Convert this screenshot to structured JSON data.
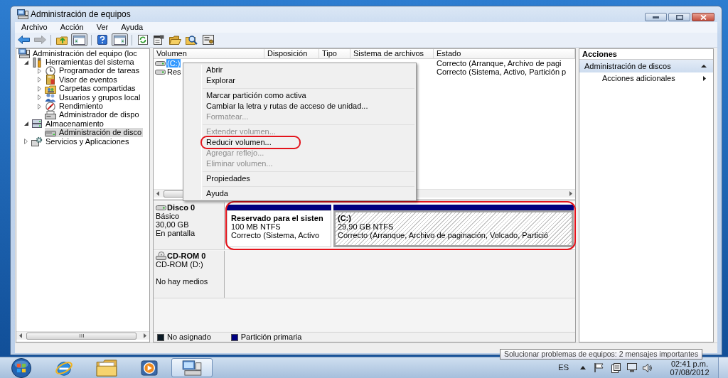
{
  "window": {
    "title": "Administración de equipos"
  },
  "menu_bar": [
    {
      "label": "Archivo"
    },
    {
      "label": "Acción"
    },
    {
      "label": "Ver"
    },
    {
      "label": "Ayuda"
    }
  ],
  "toolbar": [
    {
      "kind": "back",
      "disabled": false,
      "pressed": false
    },
    {
      "kind": "forward",
      "disabled": true,
      "pressed": false
    },
    {
      "kind": "separator"
    },
    {
      "kind": "up",
      "disabled": false,
      "pressed": false
    },
    {
      "kind": "console-tree",
      "disabled": false,
      "pressed": true
    },
    {
      "kind": "separator"
    },
    {
      "kind": "help",
      "disabled": false,
      "pressed": false
    },
    {
      "kind": "action-pane",
      "disabled": false,
      "pressed": true
    },
    {
      "kind": "separator"
    },
    {
      "kind": "refresh",
      "disabled": false,
      "pressed": false
    },
    {
      "kind": "properties",
      "disabled": false,
      "pressed": false
    },
    {
      "kind": "open",
      "disabled": false,
      "pressed": false
    },
    {
      "kind": "find",
      "disabled": false,
      "pressed": false
    },
    {
      "kind": "settings",
      "disabled": false,
      "pressed": false
    }
  ],
  "tree": {
    "label": "Administración del equipo (loc",
    "kind": "computer",
    "selected": false,
    "children": [
      {
        "label": "Herramientas del sistema",
        "kind": "tools",
        "expanded": true,
        "selected": false,
        "children": [
          {
            "label": "Programador de tareas",
            "kind": "clock",
            "expanded": false,
            "selected": false
          },
          {
            "label": "Visor de eventos",
            "kind": "events",
            "expanded": false,
            "selected": false
          },
          {
            "label": "Carpetas compartidas",
            "kind": "shared-folder",
            "expanded": false,
            "selected": false
          },
          {
            "label": "Usuarios y grupos local",
            "kind": "users",
            "expanded": false,
            "selected": false
          },
          {
            "label": "Rendimiento",
            "kind": "performance",
            "expanded": false,
            "selected": false
          },
          {
            "label": "Administrador de dispo",
            "kind": "devices",
            "selected": false
          }
        ]
      },
      {
        "label": "Almacenamiento",
        "kind": "storage",
        "expanded": true,
        "selected": false,
        "children": [
          {
            "label": "Administración de disco",
            "kind": "disk",
            "selected": true
          }
        ]
      },
      {
        "label": "Servicios y Aplicaciones",
        "kind": "services",
        "expanded": false,
        "selected": false
      }
    ]
  },
  "volume_table": {
    "columns": [
      "Volumen",
      "Disposición",
      "Tipo",
      "Sistema de archivos",
      "Estado"
    ],
    "rows": [
      {
        "volume": "(C:)",
        "status": "Correcto (Arranque, Archivo de pagi",
        "selected": true
      },
      {
        "volume": "Res",
        "status": "Correcto (Sistema, Activo, Partición p",
        "selected": false
      }
    ]
  },
  "context_menu": {
    "items": [
      {
        "kind": "item",
        "label": "Abrir",
        "disabled": false,
        "circled": false
      },
      {
        "kind": "item",
        "label": "Explorar",
        "disabled": false,
        "circled": false
      },
      {
        "kind": "separator"
      },
      {
        "kind": "item",
        "label": "Marcar partición como activa",
        "disabled": false,
        "circled": false
      },
      {
        "kind": "item",
        "label": "Cambiar la letra y rutas de acceso de unidad...",
        "disabled": false,
        "circled": false
      },
      {
        "kind": "item",
        "label": "Formatear...",
        "disabled": true,
        "circled": false
      },
      {
        "kind": "separator"
      },
      {
        "kind": "item",
        "label": "Extender volumen...",
        "disabled": true,
        "circled": false
      },
      {
        "kind": "item",
        "label": "Reducir volumen...",
        "disabled": false,
        "circled": true
      },
      {
        "kind": "item",
        "label": "Agregar reflejo...",
        "disabled": true,
        "circled": false
      },
      {
        "kind": "item",
        "label": "Eliminar volumen...",
        "disabled": true,
        "circled": false
      },
      {
        "kind": "separator"
      },
      {
        "kind": "item",
        "label": "Propiedades",
        "disabled": false,
        "circled": false
      },
      {
        "kind": "separator"
      },
      {
        "kind": "item",
        "label": "Ayuda",
        "disabled": false,
        "circled": false
      }
    ]
  },
  "disks": [
    {
      "kind": "disk",
      "name": "Disco 0",
      "type": "Básico",
      "size": "30,00 GB",
      "status": "En pantalla",
      "circled": true,
      "partitions": [
        {
          "name": "Reservado para el sisten",
          "size": "100 MB NTFS",
          "status": "Correcto (Sistema, Activo",
          "selected": false
        },
        {
          "name": "(C:)",
          "size": "29,90 GB NTFS",
          "status": "Correcto (Arranque, Archivo de paginación, Volcado, Partició",
          "selected": true
        }
      ]
    },
    {
      "kind": "cdrom",
      "name": "CD-ROM 0",
      "type": "CD-ROM (D:)",
      "status": "No hay medios",
      "circled": false
    }
  ],
  "legend": [
    {
      "label": "No asignado",
      "color": "#0b1a25"
    },
    {
      "label": "Partición primaria",
      "color": "#000080"
    }
  ],
  "actions": {
    "title": "Acciones",
    "sections": [
      {
        "label": "Administración de discos",
        "expanded": true,
        "items": [
          {
            "label": "Acciones adicionales"
          }
        ]
      }
    ]
  },
  "taskbar": {
    "apps": [
      {
        "kind": "browser",
        "active": false
      },
      {
        "kind": "folder",
        "active": false
      },
      {
        "kind": "media",
        "active": false
      },
      {
        "kind": "computer",
        "active": true
      }
    ],
    "tray": {
      "language": "ES",
      "time": "02:41 p.m.",
      "date": "07/08/2012"
    }
  },
  "tooltip": {
    "text": "Solucionar problemas de equipos: 2 mensajes importantes"
  }
}
